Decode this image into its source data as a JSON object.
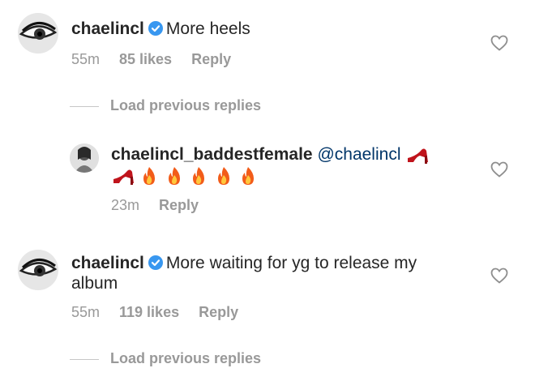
{
  "comments": [
    {
      "username": "chaelincl",
      "text": "More heels",
      "time": "55m",
      "likes": "85 likes",
      "reply": "Reply",
      "load_more": "Load previous replies"
    },
    {
      "username": "chaelincl_baddestfemale",
      "mention": "@chaelincl",
      "time": "23m",
      "reply": "Reply",
      "emojis": [
        "high-heel",
        "high-heel",
        "fire",
        "fire",
        "fire",
        "fire",
        "fire"
      ]
    },
    {
      "username": "chaelincl",
      "text_line1": "More waiting for yg to release my",
      "text_line2": "album",
      "time": "55m",
      "likes": "119 likes",
      "reply": "Reply",
      "load_more": "Load previous replies"
    }
  ],
  "colors": {
    "verified": "#3897f0",
    "meta": "#999999",
    "mention": "#003569",
    "heart_outline": "#8e8e8e"
  }
}
